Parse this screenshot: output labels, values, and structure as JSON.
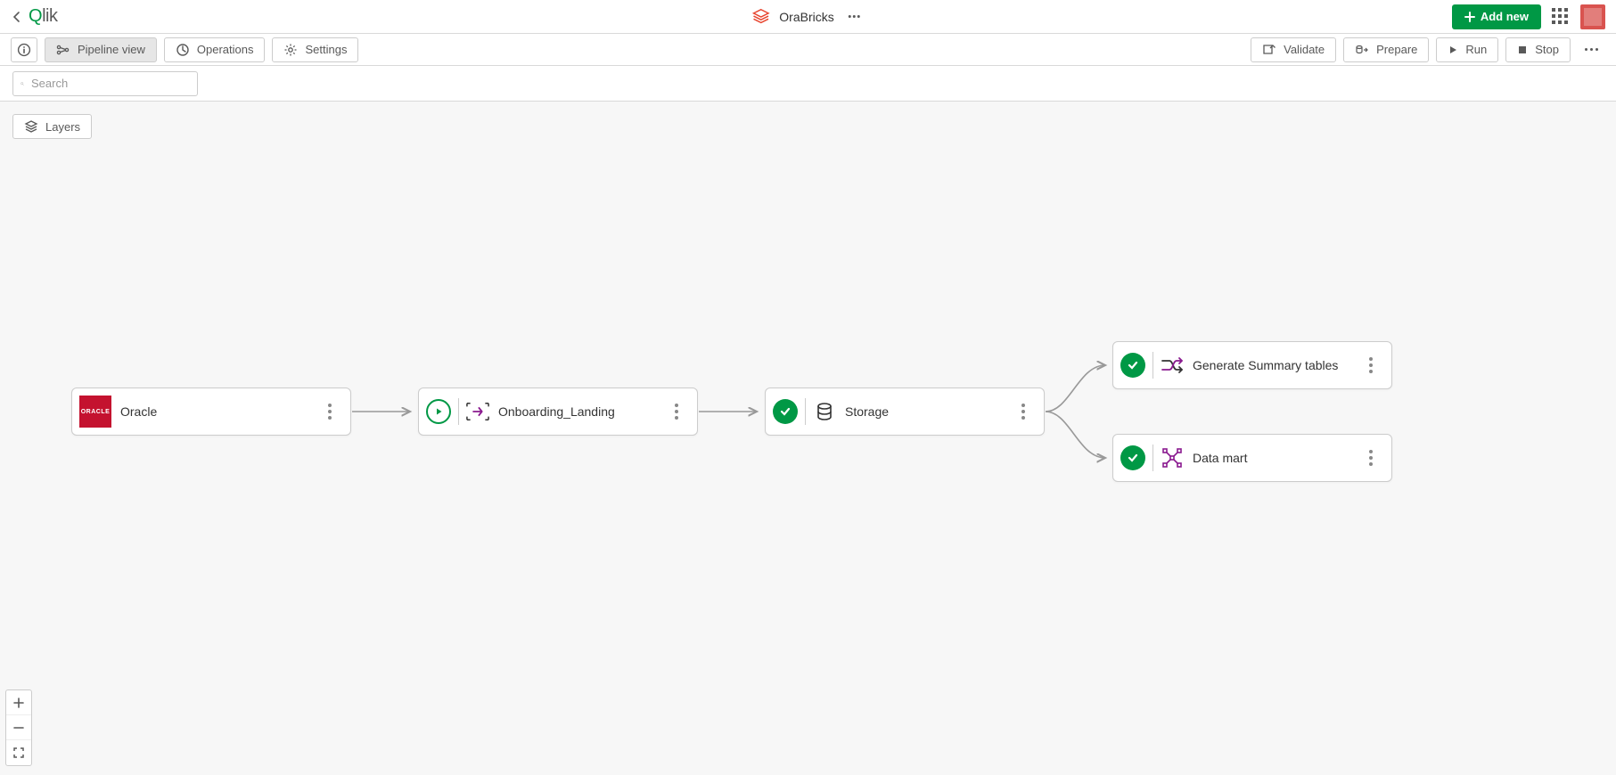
{
  "header": {
    "project_name": "OraBricks",
    "add_new_label": "Add new"
  },
  "toolbar": {
    "pipeline_view": "Pipeline view",
    "operations": "Operations",
    "settings": "Settings",
    "validate": "Validate",
    "prepare": "Prepare",
    "run": "Run",
    "stop": "Stop"
  },
  "search": {
    "placeholder": "Search"
  },
  "layers_label": "Layers",
  "nodes": {
    "oracle": "Oracle",
    "onboarding": "Onboarding_Landing",
    "storage": "Storage",
    "summary": "Generate Summary tables",
    "datamart": "Data mart"
  },
  "colors": {
    "accent_green": "#009845",
    "magenta": "#8a1a8f"
  }
}
